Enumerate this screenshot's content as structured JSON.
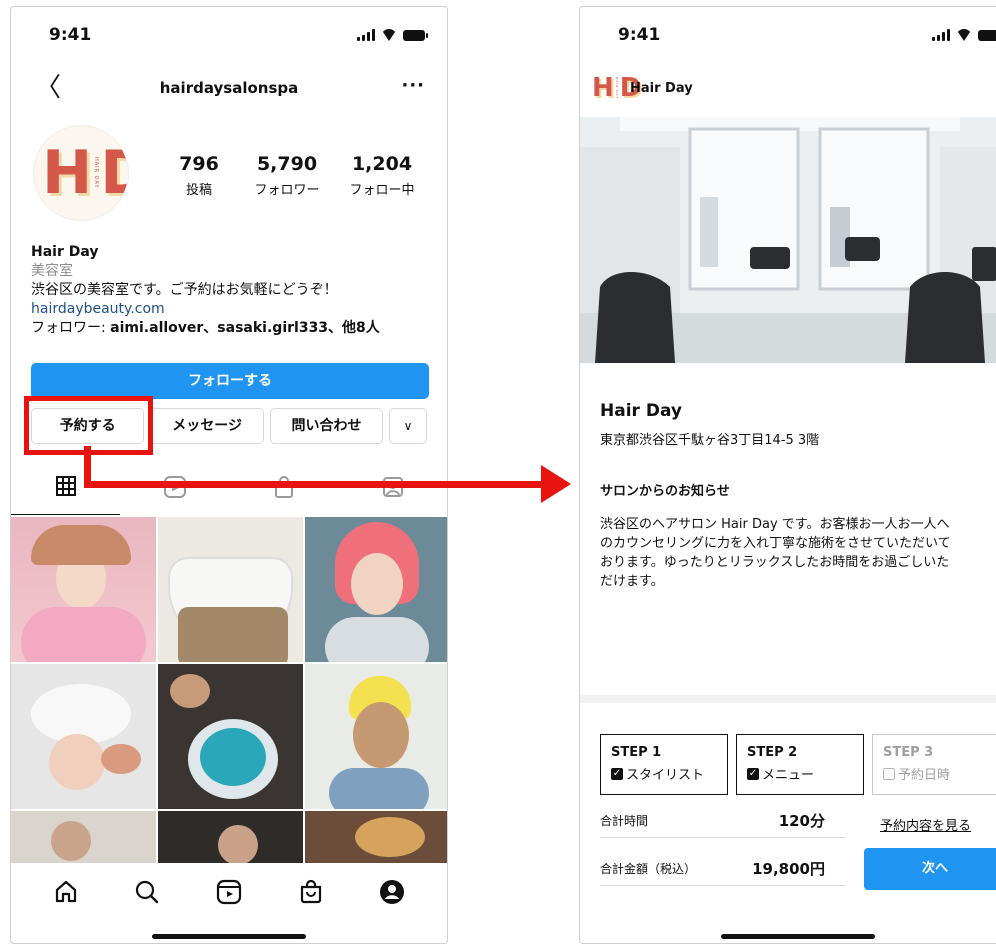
{
  "status": {
    "time": "9:41"
  },
  "profile": {
    "username": "hairdaysalonspa",
    "more": "···",
    "back": "〈",
    "logo": {
      "left": "H",
      "right": "D",
      "middle": "HAIR DAY"
    },
    "stats": [
      {
        "num": "796",
        "label": "投稿"
      },
      {
        "num": "5,790",
        "label": "フォロワー"
      },
      {
        "num": "1,204",
        "label": "フォロー中"
      }
    ],
    "bio": {
      "name": "Hair Day",
      "category": "美容室",
      "description": "渋谷区の美容室です。ご予約はお気軽にどうぞ！",
      "link": "hairdaybeauty.com",
      "followers_prefix": "フォロワー: ",
      "followers_names": "aimi.allover、sasaki.girl333、他8人"
    },
    "follow_label": "フォローする",
    "reserve_label": "予約する",
    "message_label": "メッセージ",
    "contact_label": "問い合わせ",
    "dropdown": "∨"
  },
  "booking": {
    "brand": "Hair Day",
    "name": "Hair Day",
    "address": "東京都渋谷区千駄ヶ谷3丁目14-5 3階",
    "news_title": "サロンからのお知らせ",
    "news_body": "渋谷区のヘアサロン Hair Day です。お客様お一人お一人へ\nのカウンセリングに力を入れ丁寧な施術をさせていただいて\nおります。ゆったりとリラックスしたお時間をお過ごしいた\nだけます。",
    "steps": [
      {
        "title": "STEP 1",
        "value": "スタイリスト",
        "checked": true
      },
      {
        "title": "STEP 2",
        "value": "メニュー",
        "checked": true
      },
      {
        "title": "STEP 3",
        "value": "予約日時",
        "checked": false
      }
    ],
    "total_time_label": "合計時間",
    "total_time": "120分",
    "total_price_label": "合計金額（税込）",
    "total_price": "19,800円",
    "view_details": "予約内容を見る",
    "next_label": "次へ"
  },
  "colors": {
    "accent_blue": "#1f95f1",
    "highlight_red": "#e8120f",
    "logo_red": "#d4584a",
    "logo_cream": "#f3d9a6"
  },
  "icons": [
    "grid-icon",
    "reels-icon",
    "shop-icon",
    "tagged-icon",
    "home-icon",
    "search-icon",
    "profile-icon"
  ]
}
